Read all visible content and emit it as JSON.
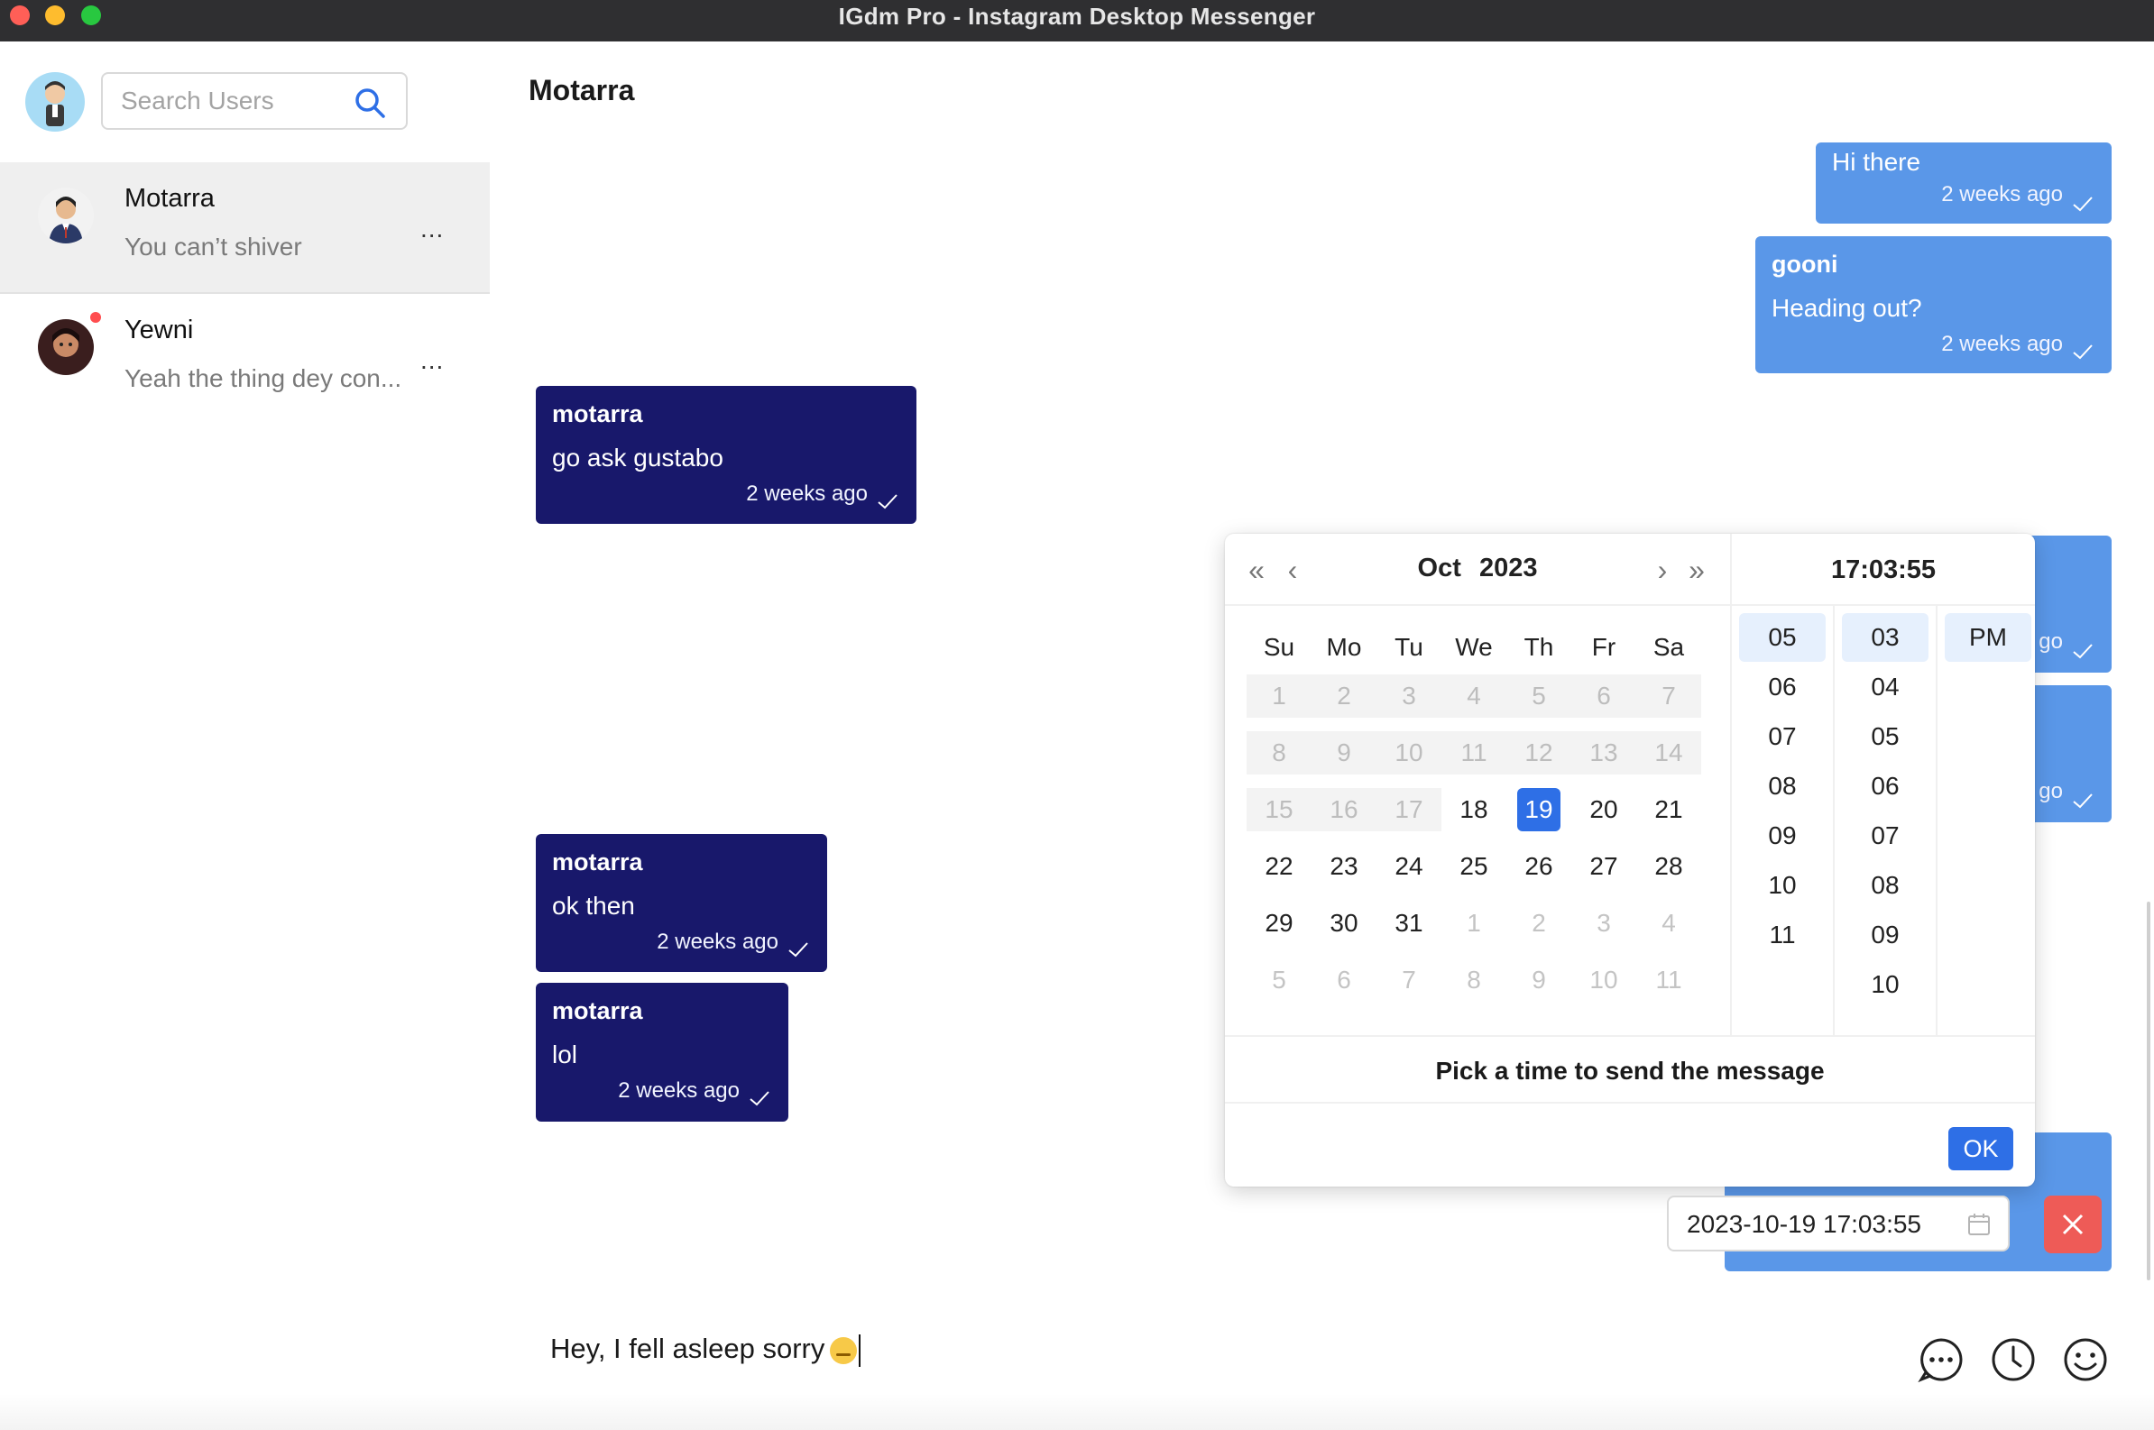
{
  "window": {
    "title": "IGdm Pro - Instagram Desktop Messenger"
  },
  "sidebar": {
    "search_placeholder": "Search Users",
    "conversations": [
      {
        "name": "Motarra",
        "preview": "You can’t shiver",
        "more": "...",
        "active": true,
        "unread": false
      },
      {
        "name": "Yewni",
        "preview": "Yeah the thing dey con...",
        "more": "...",
        "active": false,
        "unread": true
      }
    ]
  },
  "chat": {
    "title": "Motarra",
    "messages": [
      {
        "direction": "out",
        "sender": "",
        "text": "Hi there",
        "time": "2 weeks ago"
      },
      {
        "direction": "out",
        "sender": "gooni",
        "text": "Heading out?",
        "time": "2 weeks ago"
      },
      {
        "direction": "in",
        "sender": "motarra",
        "text": "go ask gustabo",
        "time": "2 weeks ago"
      },
      {
        "direction": "out",
        "sender": "",
        "text": "",
        "time": "go"
      },
      {
        "direction": "out",
        "sender": "",
        "text": "",
        "time": "go"
      },
      {
        "direction": "in",
        "sender": "motarra",
        "text": "ok then",
        "time": "2 weeks ago"
      },
      {
        "direction": "in",
        "sender": "motarra",
        "text": "lol",
        "time": "2 weeks ago"
      }
    ]
  },
  "picker": {
    "month": "Oct",
    "year": "2023",
    "time_display": "17:03:55",
    "weekdays": [
      "Su",
      "Mo",
      "Tu",
      "We",
      "Th",
      "Fr",
      "Sa"
    ],
    "weeks": [
      [
        {
          "d": "1",
          "s": "disabled"
        },
        {
          "d": "2",
          "s": "disabled"
        },
        {
          "d": "3",
          "s": "disabled"
        },
        {
          "d": "4",
          "s": "disabled"
        },
        {
          "d": "5",
          "s": "disabled"
        },
        {
          "d": "6",
          "s": "disabled"
        },
        {
          "d": "7",
          "s": "disabled"
        }
      ],
      [
        {
          "d": "8",
          "s": "disabled"
        },
        {
          "d": "9",
          "s": "disabled"
        },
        {
          "d": "10",
          "s": "disabled"
        },
        {
          "d": "11",
          "s": "disabled"
        },
        {
          "d": "12",
          "s": "disabled"
        },
        {
          "d": "13",
          "s": "disabled"
        },
        {
          "d": "14",
          "s": "disabled"
        }
      ],
      [
        {
          "d": "15",
          "s": "disabled"
        },
        {
          "d": "16",
          "s": "disabled"
        },
        {
          "d": "17",
          "s": "disabled"
        },
        {
          "d": "18",
          "s": ""
        },
        {
          "d": "19",
          "s": "selected"
        },
        {
          "d": "20",
          "s": ""
        },
        {
          "d": "21",
          "s": ""
        }
      ],
      [
        {
          "d": "22",
          "s": ""
        },
        {
          "d": "23",
          "s": ""
        },
        {
          "d": "24",
          "s": ""
        },
        {
          "d": "25",
          "s": ""
        },
        {
          "d": "26",
          "s": ""
        },
        {
          "d": "27",
          "s": ""
        },
        {
          "d": "28",
          "s": ""
        }
      ],
      [
        {
          "d": "29",
          "s": ""
        },
        {
          "d": "30",
          "s": ""
        },
        {
          "d": "31",
          "s": ""
        },
        {
          "d": "1",
          "s": "other"
        },
        {
          "d": "2",
          "s": "other"
        },
        {
          "d": "3",
          "s": "other"
        },
        {
          "d": "4",
          "s": "other"
        }
      ],
      [
        {
          "d": "5",
          "s": "other"
        },
        {
          "d": "6",
          "s": "other"
        },
        {
          "d": "7",
          "s": "other"
        },
        {
          "d": "8",
          "s": "other"
        },
        {
          "d": "9",
          "s": "other"
        },
        {
          "d": "10",
          "s": "other"
        },
        {
          "d": "11",
          "s": "other"
        }
      ]
    ],
    "hours": [
      "05",
      "06",
      "07",
      "08",
      "09",
      "10",
      "11"
    ],
    "minutes": [
      "03",
      "04",
      "05",
      "06",
      "07",
      "08",
      "09",
      "10"
    ],
    "meridiem": [
      "PM"
    ],
    "selected": {
      "hour": "05",
      "minute": "03",
      "meridiem": "PM"
    },
    "footer_label": "Pick a time to send the message",
    "ok_label": "OK",
    "accent": "#2e6fe6"
  },
  "schedule": {
    "value": "2023-10-19 17:03:55"
  },
  "composer": {
    "text": "Hey, I fell asleep sorry"
  },
  "colors": {
    "outgoing": "#5a97e8",
    "incoming": "#18186b",
    "danger": "#ee5b57"
  },
  "icons": [
    "search-icon",
    "check-icon",
    "calendar-icon",
    "close-icon",
    "chat-bubble-icon",
    "clock-icon",
    "smiley-icon"
  ]
}
